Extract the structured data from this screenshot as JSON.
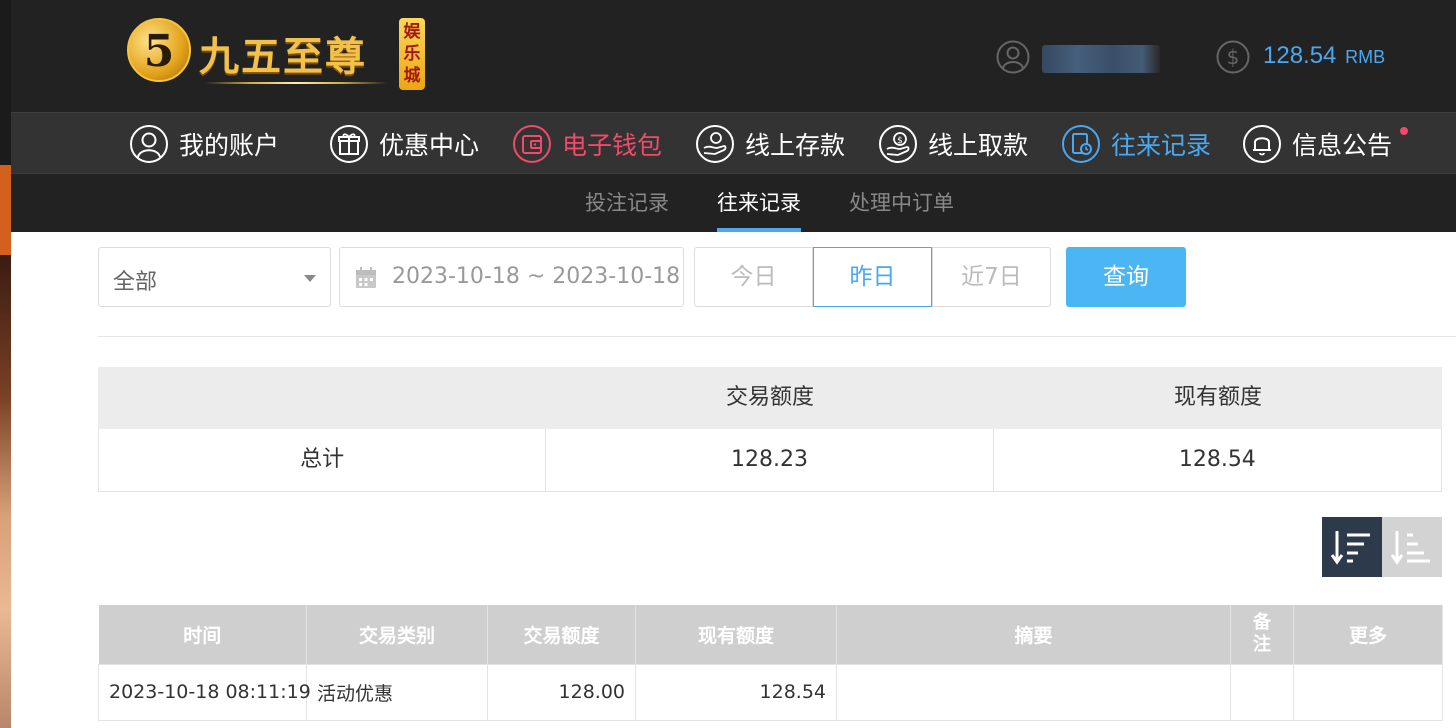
{
  "header": {
    "logo_number": "5",
    "logo_text": "九五至尊",
    "logo_badge": "娱乐城",
    "balance_amount": "128.54",
    "balance_unit": "RMB",
    "icons": [
      "user-icon",
      "coin-icon"
    ]
  },
  "mainnav": {
    "items": [
      {
        "label": "我的账户",
        "icon": "user-circle-icon"
      },
      {
        "label": "优惠中心",
        "icon": "gift-icon"
      },
      {
        "label": "电子钱包",
        "icon": "wallet-icon",
        "color": "#f24a6a"
      },
      {
        "label": "线上存款",
        "icon": "deposit-hand-icon"
      },
      {
        "label": "线上取款",
        "icon": "withdraw-coin-icon"
      },
      {
        "label": "往来记录",
        "icon": "records-icon",
        "color": "#4aa8f0"
      },
      {
        "label": "信息公告",
        "icon": "bell-icon"
      }
    ]
  },
  "subnav": {
    "tabs": [
      {
        "label": "投注记录"
      },
      {
        "label": "往来记录",
        "active": true
      },
      {
        "label": "处理中订单"
      }
    ]
  },
  "filters": {
    "type_select": "全部",
    "date_range": "2023-10-18 ~ 2023-10-18",
    "quick_today": "今日",
    "quick_yesterday": "昨日",
    "quick_week": "近7日",
    "search_button": "查询"
  },
  "summary": {
    "headers": [
      "",
      "交易额度",
      "现有额度"
    ],
    "row": [
      "总计",
      "128.23",
      "128.54"
    ]
  },
  "records": {
    "headers": [
      "时间",
      "交易类别",
      "交易额度",
      "现有额度",
      "摘要",
      "备注",
      "更多"
    ],
    "rows": [
      [
        "2023-10-18 08:11:19",
        "活动优惠",
        "128.00",
        "128.54",
        "",
        "",
        ""
      ]
    ]
  },
  "colors": {
    "accent": "#4aa8f0",
    "highlight": "#f24a6a",
    "header_bg": "#222222",
    "nav_bg": "#333333"
  }
}
